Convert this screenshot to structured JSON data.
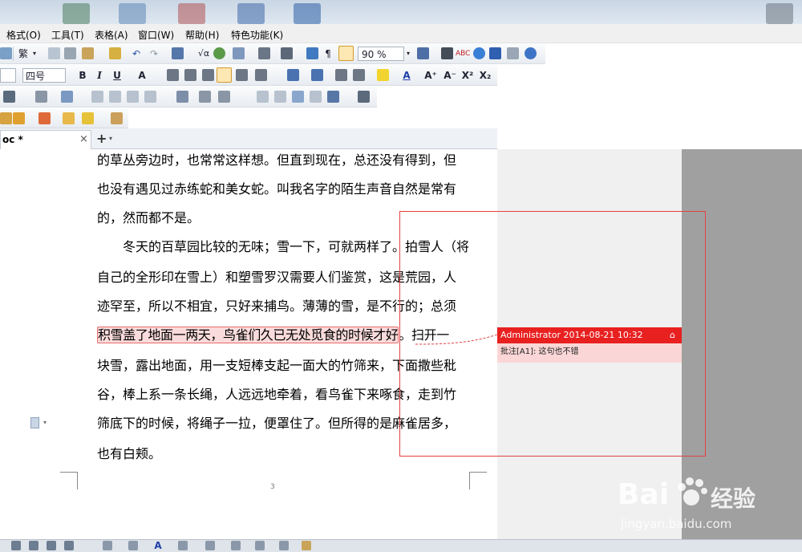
{
  "menus": [
    "格式(O)",
    "工具(T)",
    "表格(A)",
    "窗口(W)",
    "帮助(H)",
    "特色功能(K)"
  ],
  "toolbar": {
    "trad_label": "繁",
    "zoom_value": "90 %",
    "font_size_value": "四号",
    "bold": "B",
    "italic": "I",
    "underline": "U"
  },
  "tab": {
    "label": "oc *",
    "close": "×",
    "add": "+"
  },
  "document": {
    "lines": [
      "的草丛旁边时，也常常这样想。但直到现在，总还没有得到，但",
      "也没有遇见过赤练蛇和美女蛇。叫我名字的陌生声音自然是常有",
      "的，然而都不是。",
      "　　冬天的百草园比较的无味；雪一下，可就两样了。拍雪人（将",
      "自己的全形印在雪上）和塑雪罗汉需要人们鉴赏，这是荒园，人",
      "迹罕至，所以不相宜，只好来捕鸟。薄薄的雪，是不行的；总须"
    ],
    "highlight_text": "积雪盖了地面一两天，鸟雀们久已无处觅食的时候才好",
    "highlight_tail": "。扫开一",
    "lines_after": [
      "块雪，露出地面，用一支短棒支起一面大的竹筛来，下面撒些秕",
      "谷，棒上系一条长绳，人远远地牵着，看鸟雀下来啄食，走到竹",
      "筛底下的时候，将绳子一拉，便罩住了。但所得的是麻雀居多，",
      "也有白颊。"
    ],
    "page_number": "3"
  },
  "comment": {
    "author_time": "Administrator 2014-08-21 10:32",
    "text": "批注[A1]: 这句也不错"
  },
  "watermark": {
    "brand": "Bai",
    "brand_tail": "经验",
    "url": "jingyan.baidu.com"
  },
  "colors": {
    "comment_red": "#e82020",
    "highlight_pink": "#fadbdb",
    "annotation_box": "#e34040"
  }
}
